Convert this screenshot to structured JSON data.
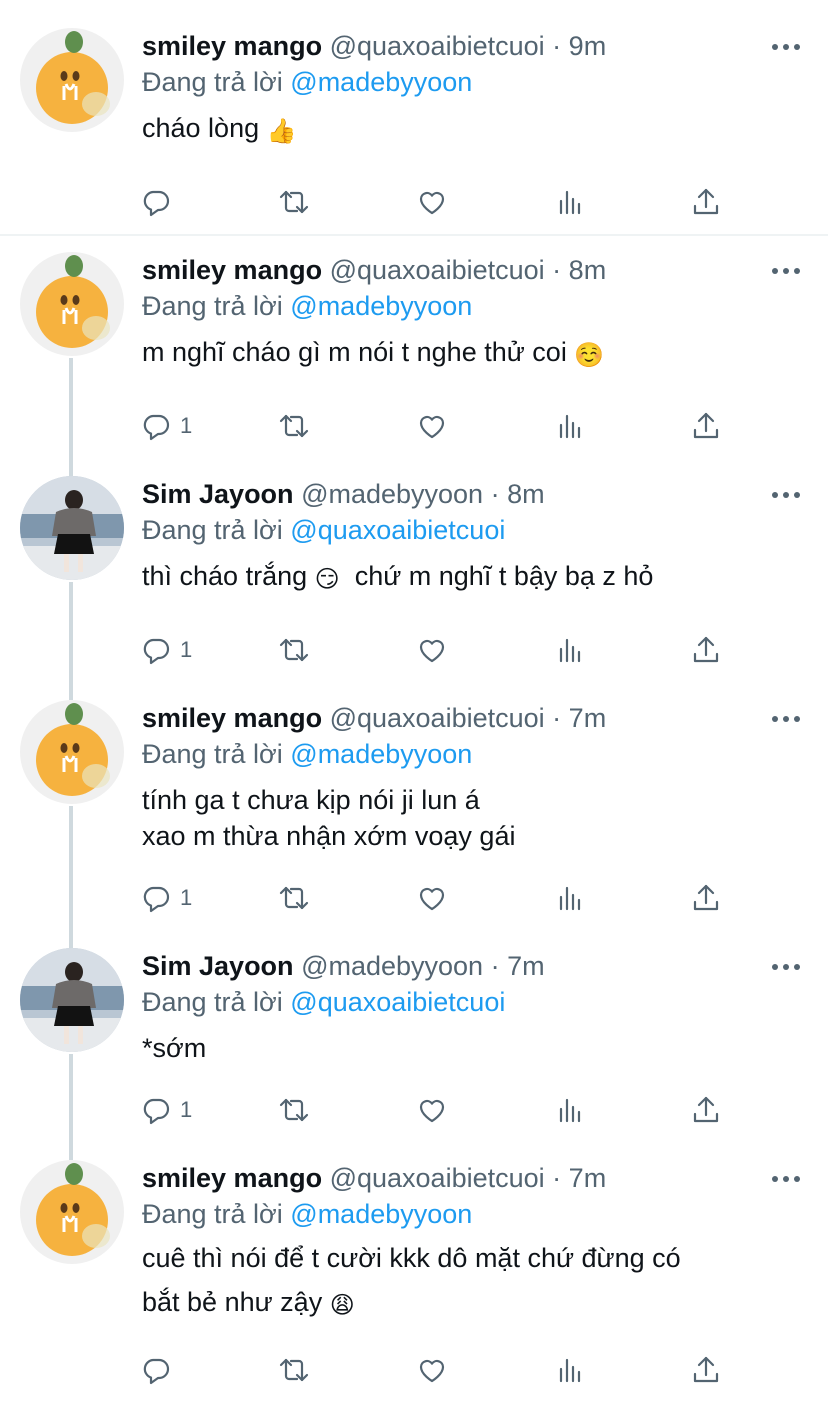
{
  "reply_prefix": "Đang trả lời",
  "tweets": [
    {
      "name": "smiley mango",
      "handle": "@quaxoaibietcuoi",
      "sep": "·",
      "time": "9m",
      "reply_to": "@madebyyoon",
      "text": "cháo lòng",
      "emoji": "👍",
      "emoji_icon": "thumbs-up-emoji",
      "replies": "",
      "avatar": "mango-avatar"
    },
    {
      "name": "smiley mango",
      "handle": "@quaxoaibietcuoi",
      "sep": "·",
      "time": "8m",
      "reply_to": "@madebyyoon",
      "text": "m nghĩ cháo gì m nói t nghe thử coi",
      "emoji": "☺️",
      "emoji_icon": "smiling-face-emoji",
      "replies": "1",
      "avatar": "mango-avatar"
    },
    {
      "name": "Sim Jayoon",
      "handle": "@madebyyoon",
      "sep": "·",
      "time": "8m",
      "reply_to": "@quaxoaibietcuoi",
      "text_a": "thì cháo trắng",
      "emoji": "😏",
      "emoji_icon": "smirking-face-emoji",
      "text_b": "chứ m nghĩ t bậy bạ z hỏ",
      "replies": "1",
      "avatar": "photo-avatar"
    },
    {
      "name": "smiley mango",
      "handle": "@quaxoaibietcuoi",
      "sep": "·",
      "time": "7m",
      "reply_to": "@madebyyoon",
      "text": "tính ga t chưa kịp nói ji lun á\nxao m thừa nhận xớm voạy gái",
      "replies": "1",
      "avatar": "mango-avatar"
    },
    {
      "name": "Sim Jayoon",
      "handle": "@madebyyoon",
      "sep": "·",
      "time": "7m",
      "reply_to": "@quaxoaibietcuoi",
      "text": "*sớm",
      "replies": "1",
      "avatar": "photo-avatar"
    },
    {
      "name": "smiley mango",
      "handle": "@quaxoaibietcuoi",
      "sep": "·",
      "time": "7m",
      "reply_to": "@madebyyoon",
      "text": "cuê thì nói để t cười kkk dô mặt chứ đừng có\nbắt bẻ như zậy",
      "emoji": "😩",
      "emoji_icon": "weary-face-emoji",
      "replies": "",
      "avatar": "mango-avatar"
    }
  ],
  "colors": {
    "text": "#0f1419",
    "secondary": "#536471",
    "mention": "#1d9bf0",
    "thread_line": "#cfd9de",
    "divider": "#eff3f4",
    "mango": "#f6b23f"
  }
}
